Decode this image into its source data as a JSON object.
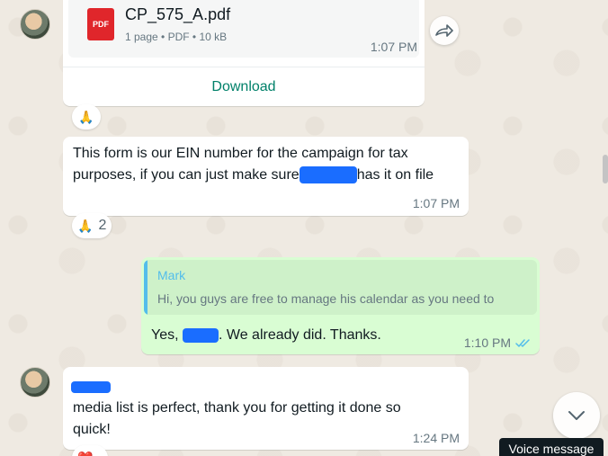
{
  "messages": {
    "file": {
      "filename": "CP_575_A.pdf",
      "pdf_badge": "PDF",
      "meta": "1 page • PDF • 10 kB",
      "time": "1:07 PM",
      "download_label": "Download",
      "reaction": "🙏"
    },
    "ein": {
      "line1": "This form is our EIN number for the campaign for tax",
      "line2_a": "purposes, if you can just make sure",
      "line2_b": "has it on file",
      "time": "1:07 PM",
      "reaction_emoji": "🙏",
      "reaction_count": "2"
    },
    "reply": {
      "quoted_author": "Mark",
      "quoted_text": "Hi, you guys are free to manage his calendar as you need to",
      "text_a": "Yes,",
      "text_b": ". We already did. Thanks.",
      "time": "1:10 PM",
      "status": "read"
    },
    "media": {
      "line1": "media list is perfect, thank you for getting it done so",
      "line2": "quick!",
      "time": "1:24 PM",
      "reaction_emoji": "❤️"
    }
  },
  "controls": {
    "forward_icon": "forward-icon",
    "scroll_icon": "chevron-down-icon",
    "tooltip": "Voice message"
  },
  "colors": {
    "wallpaper": "#efeae2",
    "incoming": "#ffffff",
    "outgoing": "#d9fdd3",
    "accent_green": "#008069",
    "quote_bar": "#53bdeb",
    "read_ticks": "#53bdeb",
    "redaction": "#1a6dff",
    "pdf_red": "#e0262b"
  }
}
